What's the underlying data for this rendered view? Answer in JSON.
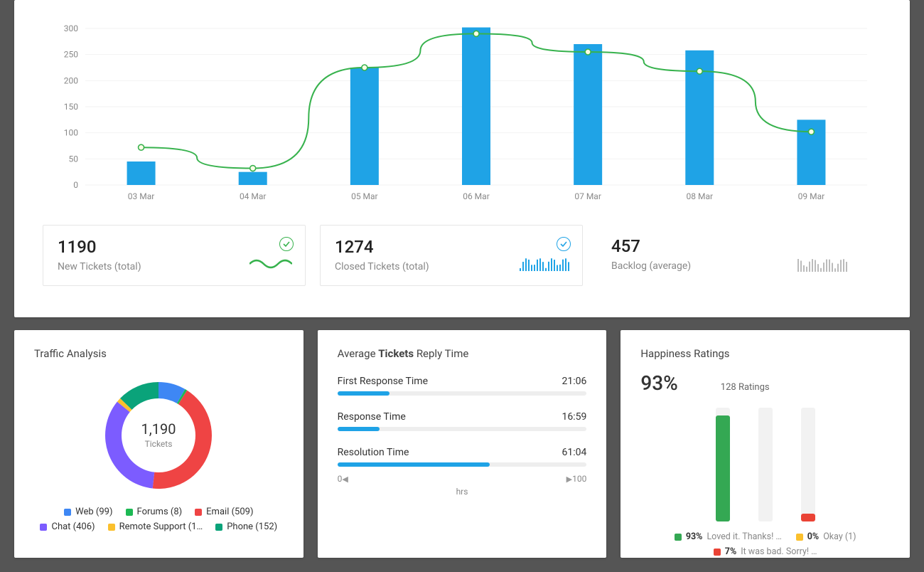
{
  "chart_data": [
    {
      "id": "tickets_week",
      "type": "bar+line",
      "categories": [
        "03 Mar",
        "04 Mar",
        "05 Mar",
        "06 Mar",
        "07 Mar",
        "08 Mar",
        "09 Mar"
      ],
      "series": [
        {
          "name": "bars",
          "type": "bar",
          "color": "#1fa3e6",
          "values": [
            45,
            25,
            225,
            302,
            270,
            258,
            125
          ]
        },
        {
          "name": "line",
          "type": "line",
          "color": "#37b24d",
          "values": [
            72,
            32,
            225,
            290,
            255,
            218,
            102
          ]
        }
      ],
      "ylim": [
        0,
        300
      ],
      "yticks": [
        0,
        50,
        100,
        150,
        200,
        250,
        300
      ]
    },
    {
      "id": "traffic_donut",
      "type": "donut",
      "title": "Traffic Analysis",
      "center_value": "1,190",
      "center_label": "Tickets",
      "items": [
        {
          "label": "Web",
          "count_label": "(99)",
          "value": 99,
          "color": "#3e87f4"
        },
        {
          "label": "Forums",
          "count_label": "(8)",
          "value": 8,
          "color": "#1db954"
        },
        {
          "label": "Email",
          "count_label": "(509)",
          "value": 509,
          "color": "#ef4444"
        },
        {
          "label": "Chat",
          "count_label": "(406)",
          "value": 406,
          "color": "#7c5cff"
        },
        {
          "label": "Remote Support",
          "count_label": "(1…",
          "value": 16,
          "color": "#fbc02d"
        },
        {
          "label": "Phone",
          "count_label": "(152)",
          "value": 152,
          "color": "#0aa37a"
        }
      ]
    },
    {
      "id": "reply_times",
      "type": "bar",
      "title": "Average  Tickets  Reply Time",
      "axis_unit": "hrs",
      "axis_min": 0,
      "axis_max": 100,
      "metrics": [
        {
          "label": "First Response Time",
          "display": "21:06",
          "value": 21
        },
        {
          "label": "Response Time",
          "display": "16:59",
          "value": 17
        },
        {
          "label": "Resolution Time",
          "display": "61:04",
          "value": 61
        }
      ]
    },
    {
      "id": "happiness",
      "type": "bar",
      "title": "Happiness Ratings",
      "main_pct": "93%",
      "ratings_label": "128 Ratings",
      "bars": [
        {
          "pct": 93,
          "color": "#34a853",
          "legend_pct": "93%",
          "legend_text": "Loved it. Thanks! …"
        },
        {
          "pct": 0,
          "color": "#fbc02d",
          "legend_pct": "0%",
          "legend_text": "Okay (1)"
        },
        {
          "pct": 7,
          "color": "#ea4335",
          "legend_pct": "7%",
          "legend_text": "It was bad. Sorry! …"
        }
      ]
    }
  ],
  "kpis": [
    {
      "value": "1190",
      "label": "New Tickets (total)",
      "check_color": "#37b24d",
      "spark": "wave-green",
      "bordered": true
    },
    {
      "value": "1274",
      "label": "Closed  Tickets (total)",
      "check_color": "#1fa3e6",
      "spark": "bars-blue",
      "bordered": true
    },
    {
      "value": "457",
      "label": "Backlog (average)",
      "check_color": null,
      "spark": "bars-gray",
      "bordered": false
    }
  ]
}
